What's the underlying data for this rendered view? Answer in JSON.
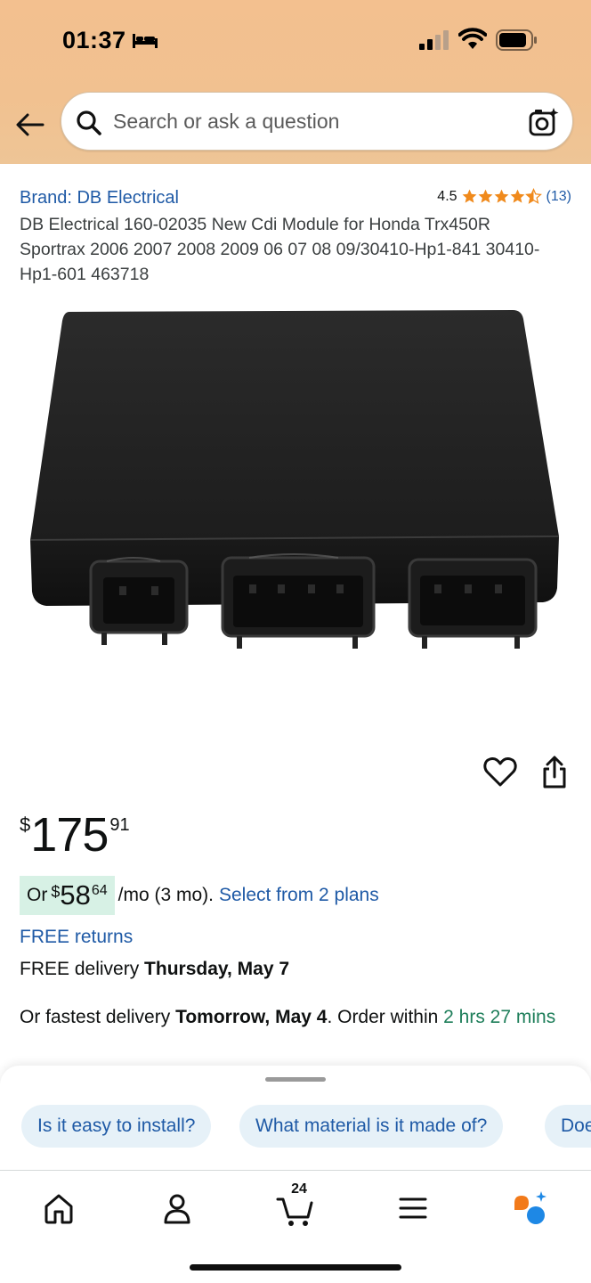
{
  "status_bar": {
    "time": "01:37",
    "icons": [
      "bed-icon",
      "signal-icon",
      "wifi-icon",
      "battery-icon"
    ]
  },
  "search": {
    "placeholder": "Search or ask a question",
    "icons": [
      "back-arrow-icon",
      "search-icon",
      "camera-icon"
    ]
  },
  "product": {
    "brand": "Brand: DB Electrical",
    "rating_value": "4.5",
    "rating_stars": 4.5,
    "rating_count": "(13)",
    "title": "DB Electrical 160-02035 New Cdi Module for Honda Trx450R Sportrax 2006 2007 2008 2009 06 07 08 09/30410-Hp1-841 30410-Hp1-601 463718"
  },
  "actions": {
    "icons": [
      "heart-icon",
      "share-icon"
    ]
  },
  "price": {
    "symbol": "$",
    "whole": "175",
    "fraction": "91"
  },
  "installment": {
    "prefix": "Or",
    "symbol": "$",
    "whole": "58",
    "fraction": "64",
    "suffix": "/mo (3 mo).",
    "link": "Select from 2 plans"
  },
  "free_returns": "FREE returns",
  "delivery": {
    "prefix": "FREE delivery",
    "date": "Thursday, May 7"
  },
  "fastest": {
    "prefix": "Or fastest delivery",
    "date": "Tomorrow, May 4",
    "middle": ". Order within",
    "countdown": "2 hrs 27 mins"
  },
  "questions": [
    "Is it easy to install?",
    "What material is it made of?",
    "Does"
  ],
  "tabbar": {
    "items": [
      "home-icon",
      "account-icon",
      "cart-icon",
      "menu-icon",
      "rufus-icon"
    ],
    "cart_count": "24"
  },
  "colors": {
    "link": "#1f5aa6",
    "star": "#f08a1c",
    "install_highlight": "#d7f1e5",
    "countdown": "#1e7e5a",
    "header_bg": "#f3c08f"
  }
}
